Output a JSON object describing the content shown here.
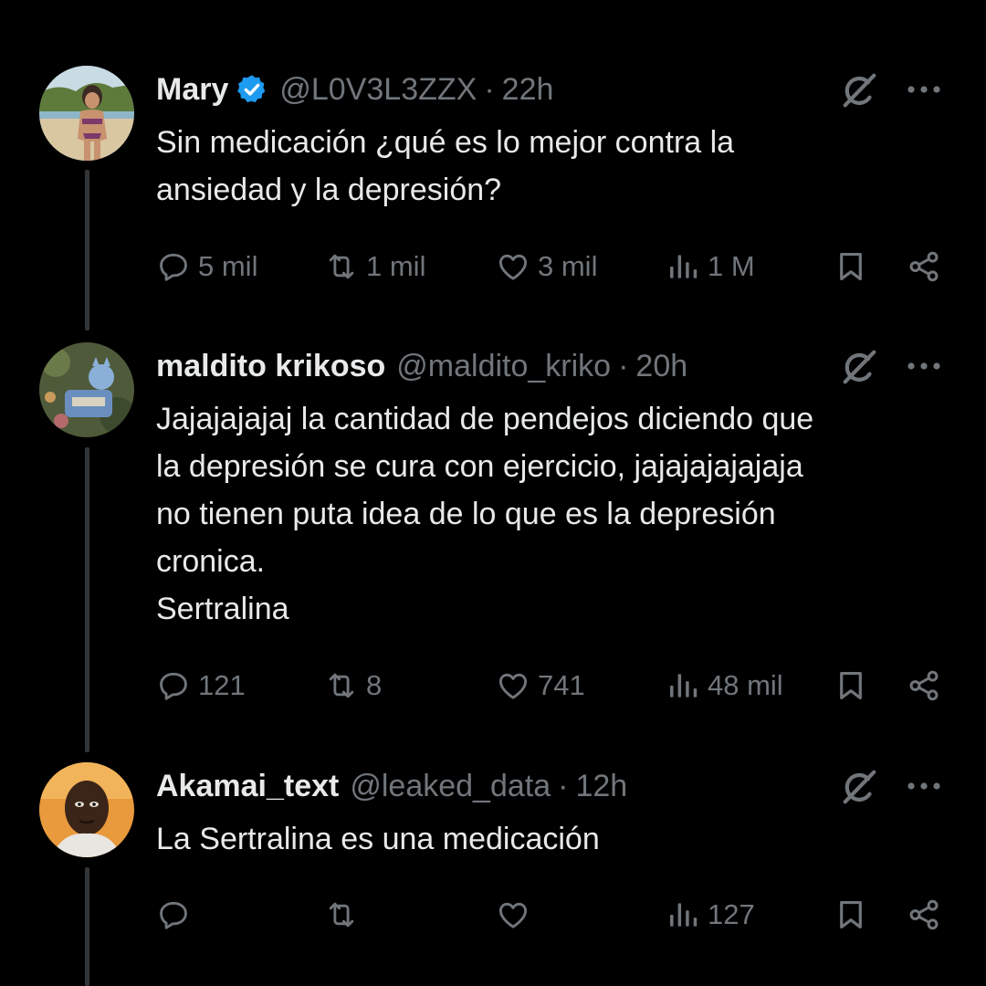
{
  "tweets": [
    {
      "name": "Mary",
      "verified": true,
      "handle": "@L0V3L3ZZX",
      "separator": "·",
      "time": "22h",
      "text": "Sin medicación ¿qué es lo mejor contra la\nansiedad y la depresión?",
      "replies": "5 mil",
      "reposts": "1 mil",
      "likes": "3 mil",
      "views": "1 M"
    },
    {
      "name": "maldito krikoso",
      "verified": false,
      "handle": "@maldito_kriko",
      "separator": "·",
      "time": "20h",
      "text": "Jajajajajaj la cantidad de pendejos diciendo que\nla depresión se cura con ejercicio, jajajajajajaja\nno tienen puta idea de lo que es la depresión\ncronica.\nSertralina",
      "replies": "121",
      "reposts": "8",
      "likes": "741",
      "views": "48 mil"
    },
    {
      "name": "Akamai_text",
      "verified": false,
      "handle": "@leaked_data",
      "separator": "·",
      "time": "12h",
      "text": "La Sertralina es una medicación",
      "replies": "",
      "reposts": "",
      "likes": "",
      "views": "127"
    }
  ],
  "icons": {
    "reply": "reply-icon",
    "repost": "repost-icon",
    "like": "heart-icon",
    "views": "views-icon",
    "bookmark": "bookmark-icon",
    "share": "share-icon",
    "grok": "grok-icon",
    "more": "more-icon",
    "verified": "verified-badge-icon"
  },
  "colors": {
    "background": "#000000",
    "text": "#e7e9ea",
    "muted": "#71767b",
    "verified": "#1d9bf0",
    "thread_line": "#333639"
  }
}
